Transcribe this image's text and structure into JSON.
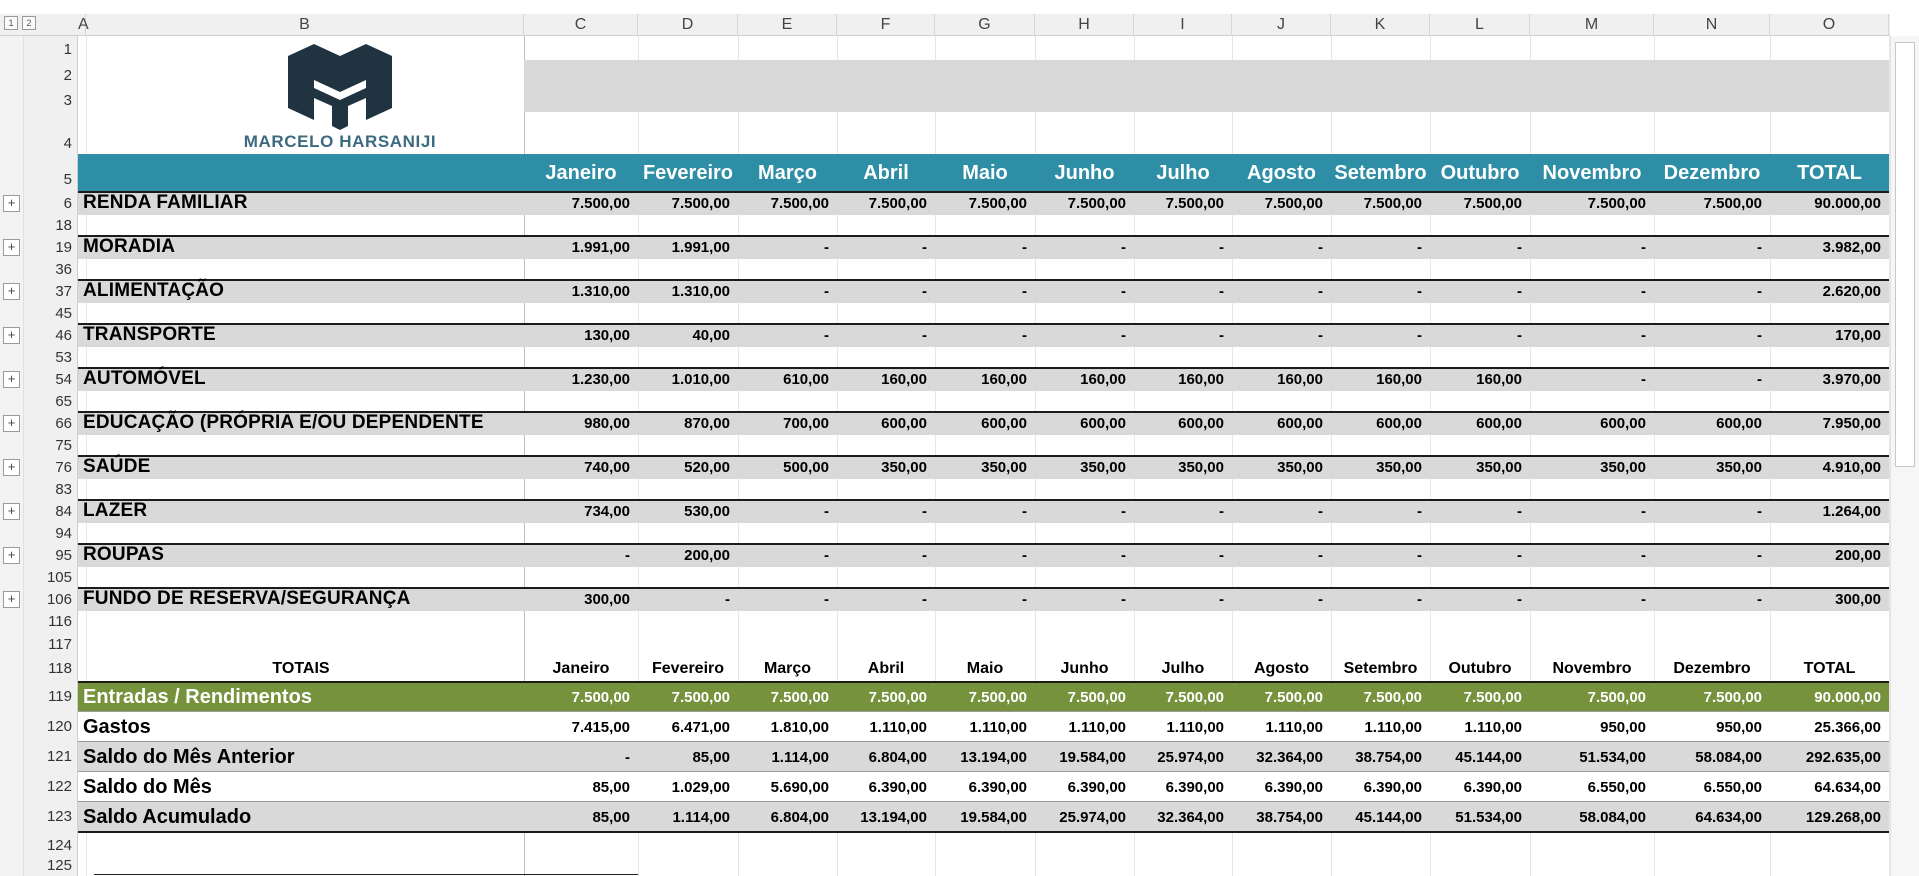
{
  "outline": {
    "levels": [
      "1",
      "2"
    ],
    "expand_glyph": "+"
  },
  "columns": [
    "A",
    "B",
    "C",
    "D",
    "E",
    "F",
    "G",
    "H",
    "I",
    "J",
    "K",
    "L",
    "M",
    "N",
    "O"
  ],
  "logo": {
    "text": "MARCELO HARSANIJI",
    "mark_color": "#1f3340",
    "text_color": "#3c6b80"
  },
  "header_row": {
    "row_label": "5",
    "months": [
      "Janeiro",
      "Fevereiro",
      "Março",
      "Abril",
      "Maio",
      "Junho",
      "Julho",
      "Agosto",
      "Setembro",
      "Outubro",
      "Novembro",
      "Dezembro"
    ],
    "total": "TOTAL",
    "band_color": "#2d8ea5"
  },
  "top_rows": [
    "1",
    "2",
    "3",
    "4"
  ],
  "categories": [
    {
      "row": "6",
      "next_row": "18",
      "label": "RENDA FAMILIAR",
      "values": [
        "7.500,00",
        "7.500,00",
        "7.500,00",
        "7.500,00",
        "7.500,00",
        "7.500,00",
        "7.500,00",
        "7.500,00",
        "7.500,00",
        "7.500,00",
        "7.500,00",
        "7.500,00"
      ],
      "total": "90.000,00"
    },
    {
      "row": "19",
      "next_row": "36",
      "label": "MORADIA",
      "values": [
        "1.991,00",
        "1.991,00",
        "-",
        "-",
        "-",
        "-",
        "-",
        "-",
        "-",
        "-",
        "-",
        "-"
      ],
      "total": "3.982,00"
    },
    {
      "row": "37",
      "next_row": "45",
      "label": "ALIMENTAÇÃO",
      "values": [
        "1.310,00",
        "1.310,00",
        "-",
        "-",
        "-",
        "-",
        "-",
        "-",
        "-",
        "-",
        "-",
        "-"
      ],
      "total": "2.620,00"
    },
    {
      "row": "46",
      "next_row": "53",
      "label": "TRANSPORTE",
      "values": [
        "130,00",
        "40,00",
        "-",
        "-",
        "-",
        "-",
        "-",
        "-",
        "-",
        "-",
        "-",
        "-"
      ],
      "total": "170,00"
    },
    {
      "row": "54",
      "next_row": "65",
      "label": "AUTOMÓVEL",
      "values": [
        "1.230,00",
        "1.010,00",
        "610,00",
        "160,00",
        "160,00",
        "160,00",
        "160,00",
        "160,00",
        "160,00",
        "160,00",
        "-",
        "-"
      ],
      "total": "3.970,00"
    },
    {
      "row": "66",
      "next_row": "75",
      "label": "EDUCAÇÃO (PRÓPRIA E/OU DEPENDENTE",
      "values": [
        "980,00",
        "870,00",
        "700,00",
        "600,00",
        "600,00",
        "600,00",
        "600,00",
        "600,00",
        "600,00",
        "600,00",
        "600,00",
        "600,00"
      ],
      "total": "7.950,00"
    },
    {
      "row": "76",
      "next_row": "83",
      "label": "SAÚDE",
      "values": [
        "740,00",
        "520,00",
        "500,00",
        "350,00",
        "350,00",
        "350,00",
        "350,00",
        "350,00",
        "350,00",
        "350,00",
        "350,00",
        "350,00"
      ],
      "total": "4.910,00"
    },
    {
      "row": "84",
      "next_row": "94",
      "label": "LAZER",
      "values": [
        "734,00",
        "530,00",
        "-",
        "-",
        "-",
        "-",
        "-",
        "-",
        "-",
        "-",
        "-",
        "-"
      ],
      "total": "1.264,00"
    },
    {
      "row": "95",
      "next_row": "105",
      "label": "ROUPAS",
      "values": [
        "-",
        "200,00",
        "-",
        "-",
        "-",
        "-",
        "-",
        "-",
        "-",
        "-",
        "-",
        "-"
      ],
      "total": "200,00"
    },
    {
      "row": "106",
      "next_row": "116",
      "label": "FUNDO DE RESERVA/SEGURANÇA",
      "values": [
        "300,00",
        "-",
        "-",
        "-",
        "-",
        "-",
        "-",
        "-",
        "-",
        "-",
        "-",
        "-"
      ],
      "total": "300,00"
    }
  ],
  "blank_row": "117",
  "totals_header": {
    "row": "118",
    "title": "TOTAIS",
    "months": [
      "Janeiro",
      "Fevereiro",
      "Março",
      "Abril",
      "Maio",
      "Junho",
      "Julho",
      "Agosto",
      "Setembro",
      "Outubro",
      "Novembro",
      "Dezembro"
    ],
    "total": "TOTAL"
  },
  "summary": [
    {
      "row": "119",
      "label": "Entradas / Rendimentos",
      "values": [
        "7.500,00",
        "7.500,00",
        "7.500,00",
        "7.500,00",
        "7.500,00",
        "7.500,00",
        "7.500,00",
        "7.500,00",
        "7.500,00",
        "7.500,00",
        "7.500,00",
        "7.500,00"
      ],
      "total": "90.000,00",
      "bg": "#76923c",
      "fg": "#ffffff"
    },
    {
      "row": "120",
      "label": "Gastos",
      "values": [
        "7.415,00",
        "6.471,00",
        "1.810,00",
        "1.110,00",
        "1.110,00",
        "1.110,00",
        "1.110,00",
        "1.110,00",
        "1.110,00",
        "1.110,00",
        "950,00",
        "950,00"
      ],
      "total": "25.366,00",
      "bg": "#ffffff",
      "fg": "#000000"
    },
    {
      "row": "121",
      "label": "Saldo do Mês Anterior",
      "values": [
        "-",
        "85,00",
        "1.114,00",
        "6.804,00",
        "13.194,00",
        "19.584,00",
        "25.974,00",
        "32.364,00",
        "38.754,00",
        "45.144,00",
        "51.534,00",
        "58.084,00"
      ],
      "total": "292.635,00",
      "bg": "#d9d9d9",
      "fg": "#000000"
    },
    {
      "row": "122",
      "label": "Saldo do Mês",
      "values": [
        "85,00",
        "1.029,00",
        "5.690,00",
        "6.390,00",
        "6.390,00",
        "6.390,00",
        "6.390,00",
        "6.390,00",
        "6.390,00",
        "6.390,00",
        "6.550,00",
        "6.550,00"
      ],
      "total": "64.634,00",
      "bg": "#ffffff",
      "fg": "#000000"
    },
    {
      "row": "123",
      "label": "Saldo Acumulado",
      "values": [
        "85,00",
        "1.114,00",
        "6.804,00",
        "13.194,00",
        "19.584,00",
        "25.974,00",
        "32.364,00",
        "38.754,00",
        "45.144,00",
        "51.534,00",
        "58.084,00",
        "64.634,00"
      ],
      "total": "129.268,00",
      "bg": "#d9d9d9",
      "fg": "#000000"
    }
  ],
  "bottom_rows": [
    "124",
    "125"
  ]
}
